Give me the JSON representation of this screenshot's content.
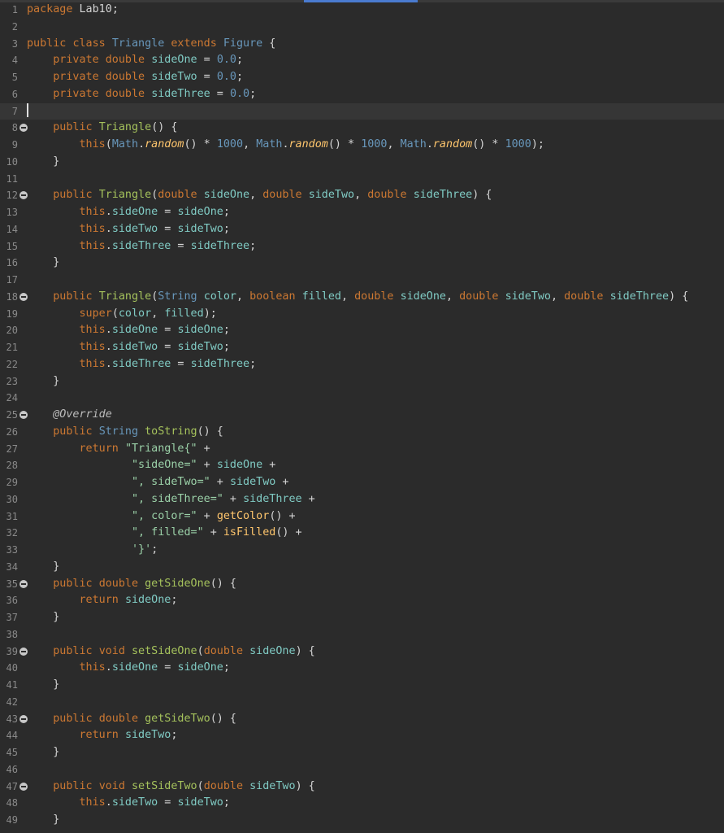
{
  "editor": {
    "lines": [
      {
        "n": "1",
        "code": "package Lab10;"
      },
      {
        "n": "2",
        "code": ""
      },
      {
        "n": "3",
        "code": "public class Triangle extends Figure {"
      },
      {
        "n": "4",
        "code": "    private double sideOne = 0.0;"
      },
      {
        "n": "5",
        "code": "    private double sideTwo = 0.0;"
      },
      {
        "n": "6",
        "code": "    private double sideThree = 0.0;"
      },
      {
        "n": "7",
        "code": ""
      },
      {
        "n": "8",
        "code": "    public Triangle() {",
        "fold": true
      },
      {
        "n": "9",
        "code": "        this(Math.random() * 1000, Math.random() * 1000, Math.random() * 1000);"
      },
      {
        "n": "10",
        "code": "    }"
      },
      {
        "n": "11",
        "code": ""
      },
      {
        "n": "12",
        "code": "    public Triangle(double sideOne, double sideTwo, double sideThree) {",
        "fold": true
      },
      {
        "n": "13",
        "code": "        this.sideOne = sideOne;"
      },
      {
        "n": "14",
        "code": "        this.sideTwo = sideTwo;"
      },
      {
        "n": "15",
        "code": "        this.sideThree = sideThree;"
      },
      {
        "n": "16",
        "code": "    }"
      },
      {
        "n": "17",
        "code": ""
      },
      {
        "n": "18",
        "code": "    public Triangle(String color, boolean filled, double sideOne, double sideTwo, double sideThree) {",
        "fold": true
      },
      {
        "n": "19",
        "code": "        super(color, filled);"
      },
      {
        "n": "20",
        "code": "        this.sideOne = sideOne;"
      },
      {
        "n": "21",
        "code": "        this.sideTwo = sideTwo;"
      },
      {
        "n": "22",
        "code": "        this.sideThree = sideThree;"
      },
      {
        "n": "23",
        "code": "    }"
      },
      {
        "n": "24",
        "code": ""
      },
      {
        "n": "25",
        "code": "    @Override",
        "fold": true
      },
      {
        "n": "26",
        "code": "    public String toString() {"
      },
      {
        "n": "27",
        "code": "        return \"Triangle{\" +"
      },
      {
        "n": "28",
        "code": "                \"sideOne=\" + sideOne +"
      },
      {
        "n": "29",
        "code": "                \", sideTwo=\" + sideTwo +"
      },
      {
        "n": "30",
        "code": "                \", sideThree=\" + sideThree +"
      },
      {
        "n": "31",
        "code": "                \", color=\" + getColor() +"
      },
      {
        "n": "32",
        "code": "                \", filled=\" + isFilled() +"
      },
      {
        "n": "33",
        "code": "                '}';"
      },
      {
        "n": "34",
        "code": "    }"
      },
      {
        "n": "35",
        "code": "    public double getSideOne() {",
        "fold": true
      },
      {
        "n": "36",
        "code": "        return sideOne;"
      },
      {
        "n": "37",
        "code": "    }"
      },
      {
        "n": "38",
        "code": ""
      },
      {
        "n": "39",
        "code": "    public void setSideOne(double sideOne) {",
        "fold": true
      },
      {
        "n": "40",
        "code": "        this.sideOne = sideOne;"
      },
      {
        "n": "41",
        "code": "    }"
      },
      {
        "n": "42",
        "code": ""
      },
      {
        "n": "43",
        "code": "    public double getSideTwo() {",
        "fold": true
      },
      {
        "n": "44",
        "code": "        return sideTwo;"
      },
      {
        "n": "45",
        "code": "    }"
      },
      {
        "n": "46",
        "code": ""
      },
      {
        "n": "47",
        "code": "    public void setSideTwo(double sideTwo) {",
        "fold": true
      },
      {
        "n": "48",
        "code": "        this.sideTwo = sideTwo;"
      },
      {
        "n": "49",
        "code": "    }"
      }
    ],
    "current_line": "7"
  },
  "icons": {
    "fold": "fold-collapse-icon",
    "caret": "text-cursor"
  },
  "colors": {
    "background": "#2b2b2b",
    "keyword": "#cc7832",
    "class_name": "#6897bb",
    "method": "#ffc66d",
    "string": "#9bd1a8",
    "field": "#80cbc4",
    "number": "#6897bb"
  }
}
